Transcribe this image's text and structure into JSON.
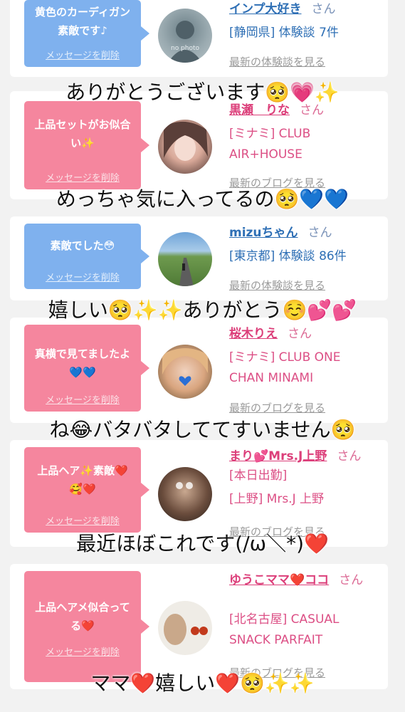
{
  "cards": [
    {
      "message": "黄色のカーディガン素敵です♪",
      "delete_label": "メッセージを削除",
      "avatar_text": "no photo",
      "name": "インプ大好き",
      "san": "さん",
      "detail": "[静岡県] 体験談 7件",
      "link": "最新の体験談を見る"
    },
    {
      "message": "上品セットがお似合い✨",
      "delete_label": "メッセージを削除",
      "name": "黒瀬　りな",
      "san": "さん",
      "detail": "[ミナミ] CLUB AIR+HOUSE",
      "link": "最新のブログを見る"
    },
    {
      "message": "素敵でした😳",
      "delete_label": "メッセージを削除",
      "name": "mizuちゃん",
      "san": "さん",
      "detail": "[東京都] 体験談 86件",
      "link": "最新の体験談を見る"
    },
    {
      "message": "真横で見てましたよ💙💙",
      "delete_label": "メッセージを削除",
      "name": "桜木りえ",
      "san": "さん",
      "detail": "[ミナミ] CLUB ONE CHAN MINAMI",
      "link": "最新のブログを見る"
    },
    {
      "message": "上品ヘア✨素敵❤️🥰❤️",
      "delete_label": "メッセージを削除",
      "name": "まり💕Mrs.J上野",
      "san": "さん",
      "name_suffix": "[本日出勤]",
      "detail": "[上野] Mrs.J 上野",
      "link": "最新のブログを見る"
    },
    {
      "message": "上品ヘアメ似合ってる❤️",
      "delete_label": "メッセージを削除",
      "name": "ゆうこママ❤️ココ",
      "san": "さん",
      "detail": "[北名古屋] CASUAL SNACK PARFAIT",
      "link": "最新のブログを見る"
    }
  ],
  "overlays": [
    "ありがとうございます🥺💗✨",
    "めっちゃ気に入ってるの🥺💙💙",
    "嬉しい🥺✨✨ありがとう☺️💕💕",
    "ね😂バタバタしててすいません🥺",
    "最近ほぼこれです(/ω＼*)❤️",
    "ママ❤️嬉しい❤️🥺✨✨"
  ],
  "colors": {
    "blue_bubble": "#7fb1ee",
    "pink_bubble": "#f5869e",
    "blue_text": "#2e6fb5",
    "pink_text": "#dc3f7a"
  }
}
